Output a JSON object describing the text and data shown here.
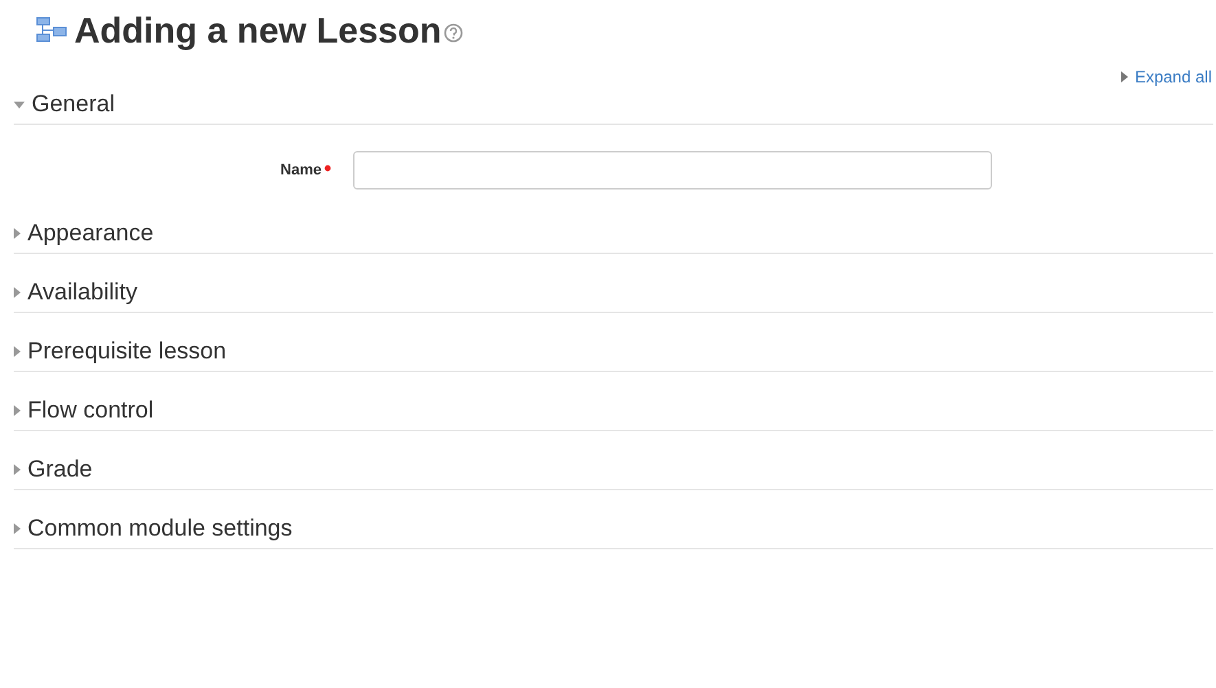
{
  "heading": {
    "title": "Adding a new Lesson"
  },
  "expand_all": "Expand all",
  "sections": [
    {
      "label": "General",
      "expanded": true,
      "fields": [
        {
          "label": "Name",
          "required": true
        }
      ]
    },
    {
      "label": "Appearance",
      "expanded": false
    },
    {
      "label": "Availability",
      "expanded": false
    },
    {
      "label": "Prerequisite lesson",
      "expanded": false
    },
    {
      "label": "Flow control",
      "expanded": false
    },
    {
      "label": "Grade",
      "expanded": false
    },
    {
      "label": "Common module settings",
      "expanded": false
    }
  ]
}
